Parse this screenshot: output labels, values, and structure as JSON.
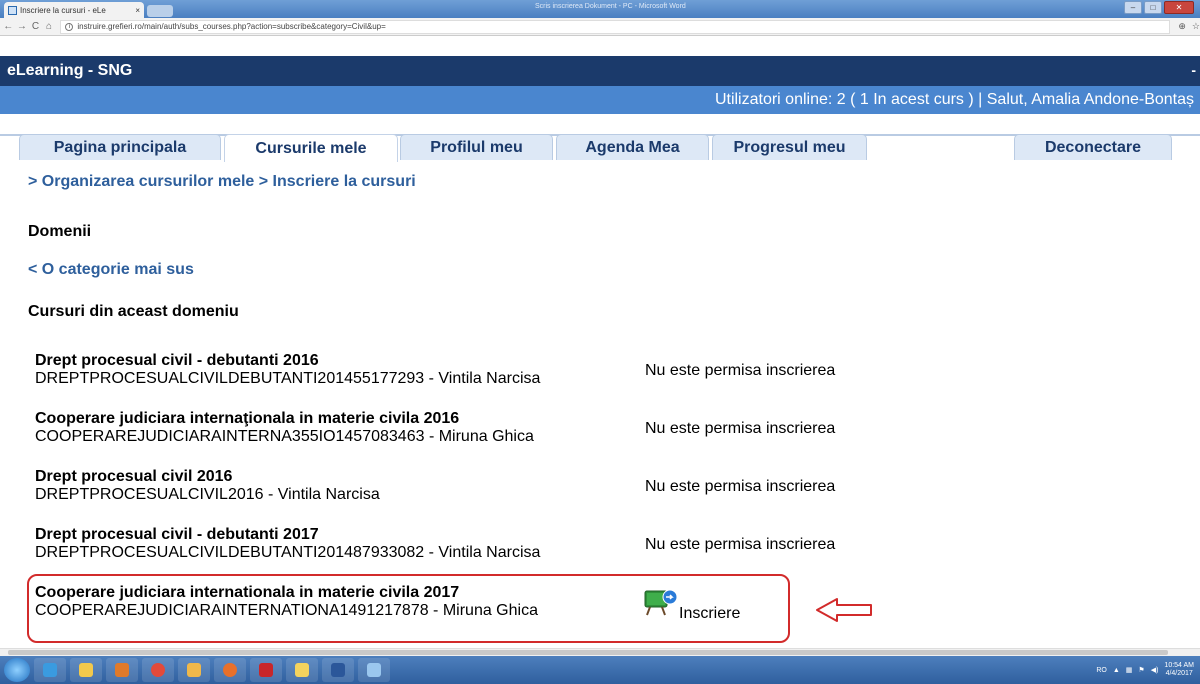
{
  "browser": {
    "tab_title": "Inscriere la cursuri - eLe",
    "tab_close": "×",
    "url": "instruire.grefieri.ro/main/auth/subs_courses.php?action=subscribe&category=Civil&up=",
    "nav_back": "←",
    "nav_forward": "→",
    "nav_reload": "C",
    "nav_home": "⌂",
    "window_title": "Scris inscrierea Dokument - PC - Microsoft Word"
  },
  "site": {
    "name": "eLearning - SNG",
    "corner_dash": "-",
    "userbar": "Utilizatori online:  2  ( 1 In acest curs  ) | Salut, Amalia Andone-Bontaș"
  },
  "nav": {
    "tabs": [
      {
        "label": "Pagina principala"
      },
      {
        "label": "Cursurile mele"
      },
      {
        "label": "Profilul meu"
      },
      {
        "label": "Agenda Mea"
      },
      {
        "label": "Progresul meu"
      }
    ],
    "logout": "Deconectare"
  },
  "breadcrumb": "> Organizarea cursurilor mele > Inscriere la cursuri",
  "domains_title": "Domenii",
  "up_link": "< O categorie mai sus",
  "courses_title": "Cursuri din aceast domeniu",
  "courses": [
    {
      "title": "Drept procesual civil - debutanti 2016",
      "code": "DREPTPROCESUALCIVILDEBUTANTI201455177293 - Vintila Narcisa",
      "status": "Nu este permisa inscrierea"
    },
    {
      "title": "Cooperare judiciara internaţionala in materie civila 2016",
      "code": "COOPERAREJUDICIARAINTERNA355IO1457083463 - Miruna Ghica",
      "status": "Nu este permisa inscrierea"
    },
    {
      "title": "Drept procesual civil 2016",
      "code": "DREPTPROCESUALCIVIL2016 - Vintila Narcisa",
      "status": "Nu este permisa inscrierea"
    },
    {
      "title": "Drept procesual civil - debutanti 2017",
      "code": "DREPTPROCESUALCIVILDEBUTANTI201487933082 - Vintila Narcisa",
      "status": "Nu este permisa inscrierea"
    },
    {
      "title": "Cooperare judiciara internationala in materie civila 2017",
      "code": "COOPERAREJUDICIARAINTERNATIONA1491217878 - Miruna Ghica",
      "status": ""
    }
  ],
  "enroll_label": "Inscriere",
  "taskbar": {
    "lang": "RO",
    "time": "10:54 AM",
    "date": "4/4/2017"
  },
  "colors": {
    "header": "#1b3a6b",
    "userbar": "#4a86cf",
    "link": "#2e5f9c",
    "highlight": "#d22b2b"
  }
}
